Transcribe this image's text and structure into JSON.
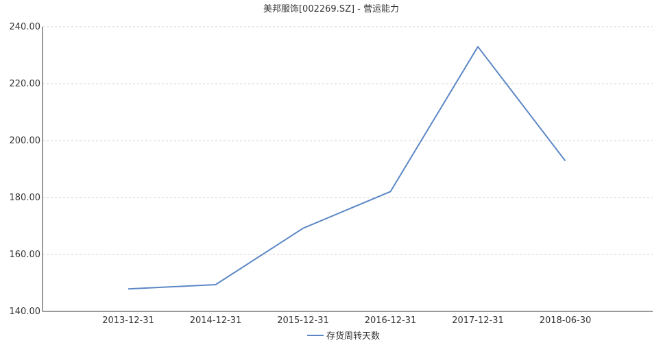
{
  "chart_data": {
    "type": "line",
    "title": "美邦服饰[002269.SZ] - 营运能力",
    "categories": [
      "2013-12-31",
      "2014-12-31",
      "2015-12-31",
      "2016-12-31",
      "2017-12-31",
      "2018-06-30"
    ],
    "series": [
      {
        "name": "存货周转天数",
        "values": [
          147.9,
          149.4,
          169.2,
          182.1,
          233.0,
          192.9
        ]
      }
    ],
    "ylim": [
      140,
      240
    ],
    "yticks": [
      140,
      160,
      180,
      200,
      220,
      240
    ],
    "yticks_labels": [
      "140.00",
      "160.00",
      "180.00",
      "200.00",
      "220.00",
      "240.00"
    ],
    "grid": true,
    "legend": "bottom-center",
    "colors": {
      "series": "#5b87c5",
      "grid": "#cfcfcf",
      "axis": "#333333",
      "text": "#333333"
    }
  }
}
